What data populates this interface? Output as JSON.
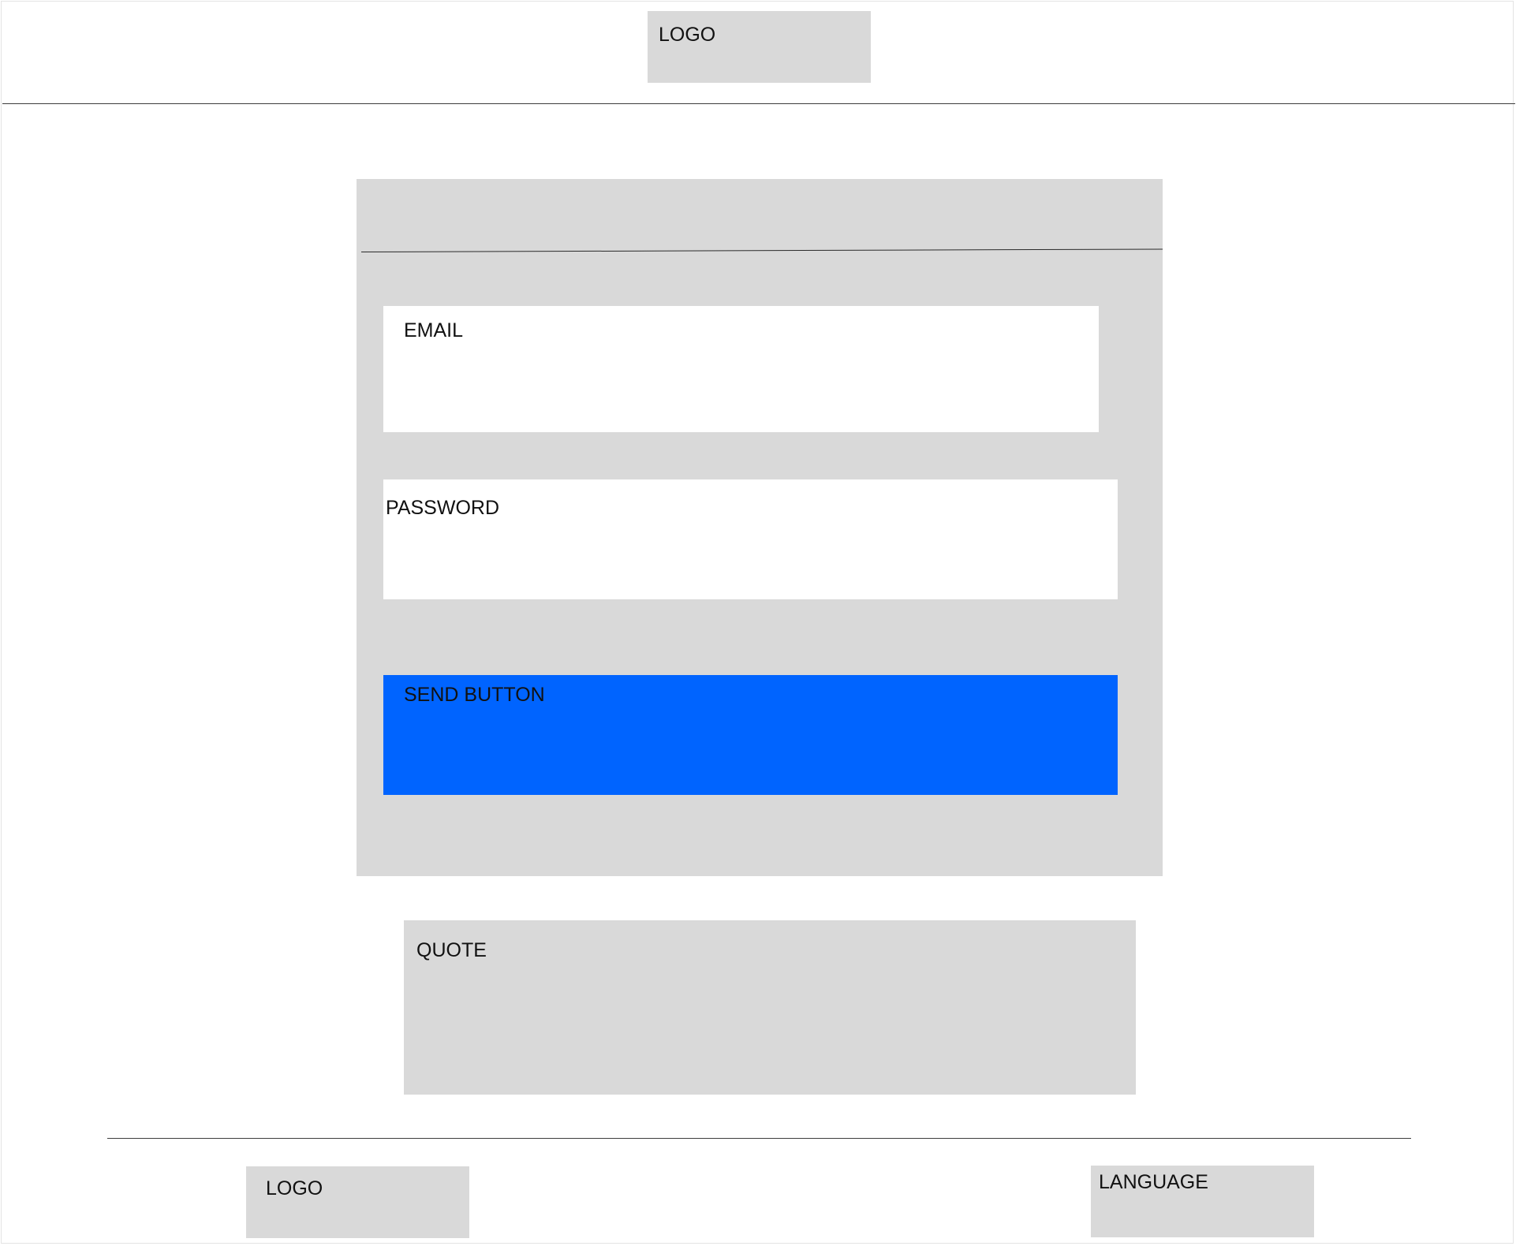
{
  "header": {
    "logo_label": "LOGO"
  },
  "login_card": {
    "email_label": "EMAIL",
    "password_label": "PASSWORD",
    "send_button_label": "SEND BUTTON"
  },
  "quote": {
    "label": "QUOTE"
  },
  "footer": {
    "logo_label": "LOGO",
    "language_label": "LANGUAGE"
  },
  "colors": {
    "placeholder_box": "#d9d9d9",
    "send_button": "#0064ff",
    "field_background": "#ffffff"
  }
}
